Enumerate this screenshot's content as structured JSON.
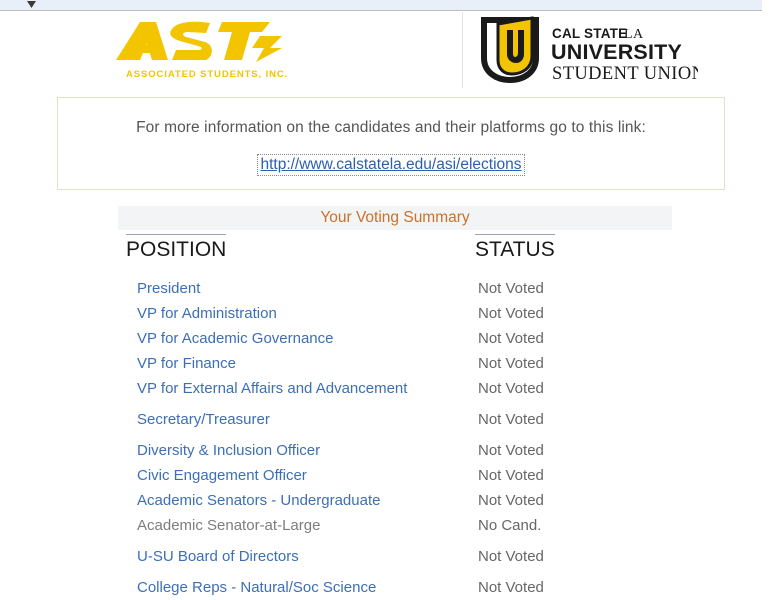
{
  "chrome": {
    "glyph_icon": "cursor-arrow-icon"
  },
  "logos": {
    "asi": {
      "name": "asi-logo",
      "mark_text": "ASI",
      "tagline": "ASSOCIATED STUDENTS, INC.",
      "color": "#f2c500"
    },
    "usu": {
      "name": "cal-state-la-university-student-union-logo",
      "shield_letter": "U",
      "line1_bold": "CAL STATE",
      "line1_light": "LA",
      "line2": "UNIVERSITY",
      "line3": "STUDENT UNION",
      "gold": "#f2c500",
      "dark": "#1a1a1a"
    }
  },
  "info": {
    "text": "For more information on the candidates and their platforms go to this link:",
    "link_label": "http://www.calstatela.edu/asi/elections"
  },
  "summary": {
    "title": "Your Voting Summary",
    "title_color": "#c8722c",
    "headers": {
      "position": "POSITION",
      "status": "STATUS"
    }
  },
  "rows": [
    {
      "position": "President",
      "status": "Not Voted",
      "is_link": true,
      "gap_before": false
    },
    {
      "position": "VP for Administration",
      "status": "Not Voted",
      "is_link": true,
      "gap_before": false
    },
    {
      "position": "VP for Academic Governance",
      "status": "Not Voted",
      "is_link": true,
      "gap_before": false
    },
    {
      "position": "VP for Finance",
      "status": "Not Voted",
      "is_link": true,
      "gap_before": false
    },
    {
      "position": "VP for External Affairs and Advancement",
      "status": "Not Voted",
      "is_link": true,
      "gap_before": false
    },
    {
      "position": "Secretary/Treasurer",
      "status": "Not Voted",
      "is_link": true,
      "gap_before": true
    },
    {
      "position": "Diversity & Inclusion Officer",
      "status": "Not Voted",
      "is_link": true,
      "gap_before": true
    },
    {
      "position": "Civic Engagement Officer",
      "status": "Not Voted",
      "is_link": true,
      "gap_before": false
    },
    {
      "position": "Academic Senators - Undergraduate",
      "status": "Not Voted",
      "is_link": true,
      "gap_before": false
    },
    {
      "position": "Academic Senator-at-Large",
      "status": "No Cand.",
      "is_link": false,
      "gap_before": false
    },
    {
      "position": "U-SU Board of Directors",
      "status": "Not Voted",
      "is_link": true,
      "gap_before": true
    },
    {
      "position": "College Reps - Natural/Soc Science",
      "status": "Not Voted",
      "is_link": true,
      "gap_before": true
    }
  ]
}
